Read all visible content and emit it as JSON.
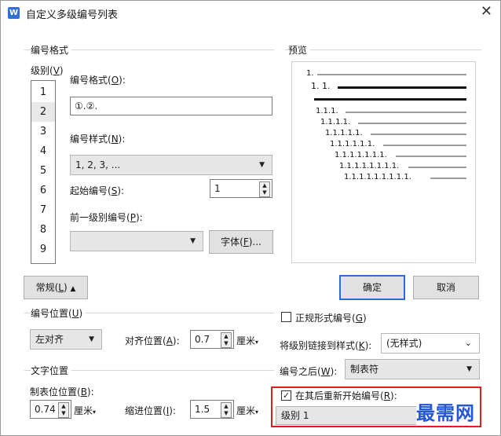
{
  "window": {
    "title": "自定义多级编号列表",
    "app_icon_letter": "W"
  },
  "numbering_format_group": {
    "title": "编号格式",
    "level_label": "级别(V)",
    "level_label_text": "级别(",
    "level_label_key": "V",
    "levels": [
      "1",
      "2",
      "3",
      "4",
      "5",
      "6",
      "7",
      "8",
      "9"
    ],
    "selected_level": "2",
    "format_label_text": "编号格式(",
    "format_label_key": "O",
    "format_value": "①.②.",
    "style_label_text": "编号样式(",
    "style_label_key": "N",
    "style_value": "1, 2, 3, ...",
    "start_label_text": "起始编号(",
    "start_label_key": "S",
    "start_value": "1",
    "prev_level_label_text": "前一级别编号(",
    "prev_level_label_key": "P",
    "prev_level_value": "",
    "font_button_text": "字体(",
    "font_button_key": "F",
    "font_button_suffix": ")..."
  },
  "preview_group": {
    "title": "预览",
    "lines": [
      "1.",
      "1. 1.",
      "1.1.1.",
      "1.1.1.1.",
      "1.1.1.1.1.",
      "1.1.1.1.1.1.",
      "1.1.1.1.1.1.1.",
      "1.1.1.1.1.1.1.1.",
      "1.1.1.1.1.1.1.1.1."
    ]
  },
  "general_button": {
    "text": "常规(",
    "key": "L",
    "suffix": ")",
    "icon": "chevron-up-icon"
  },
  "ok_button": "确定",
  "cancel_button": "取消",
  "number_position_group": {
    "title_text": "编号位置(",
    "title_key": "U",
    "align_value": "左对齐",
    "align_pos_label_text": "对齐位置(",
    "align_pos_label_key": "A",
    "align_pos_value": "0.7",
    "unit": "厘米"
  },
  "text_position_group": {
    "title": "文字位置",
    "tab_pos_label_text": "制表位位置(",
    "tab_pos_label_key": "B",
    "tab_pos_value": "0.74",
    "indent_label_text": "缩进位置(",
    "indent_label_key": "I",
    "indent_value": "1.5",
    "unit": "厘米"
  },
  "right_options": {
    "legal_style_text": "正规形式编号(",
    "legal_style_key": "G",
    "legal_style_checked": false,
    "link_style_text": "将级别链接到样式(",
    "link_style_key": "K",
    "link_style_value": "(无样式)",
    "after_number_text": "编号之后(",
    "after_number_key": "W",
    "after_number_value": "制表符",
    "restart_text": "在其后重新开始编号(",
    "restart_key": "R",
    "restart_checked": true,
    "restart_level_value": "级别 1"
  },
  "watermark": "最需网",
  "colors": {
    "accent": "#2b6bd6",
    "highlight": "#e21b1b",
    "watermark": "#2357d6"
  }
}
